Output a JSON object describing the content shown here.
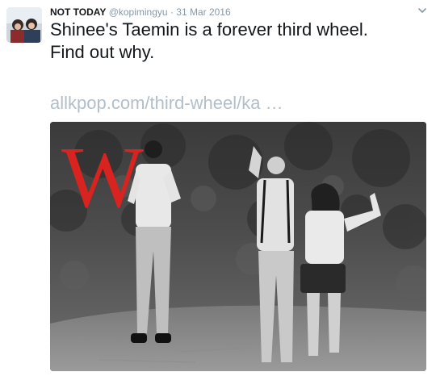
{
  "tweet": {
    "display_name": "NOT TODAY",
    "handle": "@kopimingyu",
    "separator": "·",
    "date": "31 Mar 2016",
    "text_line1": "Shinee's Taemin is a forever third wheel.",
    "text_line2": "Find out why.",
    "link_text": "allkpop.com/third-wheel/ka …"
  },
  "media": {
    "logo_letter": "W",
    "logo_color": "#d8231f",
    "description_icon": "photo"
  },
  "icons": {
    "caret": "chevron-down-icon"
  },
  "colors": {
    "name": "#14171a",
    "meta": "#8899a6",
    "link": "#b3bfc8"
  }
}
